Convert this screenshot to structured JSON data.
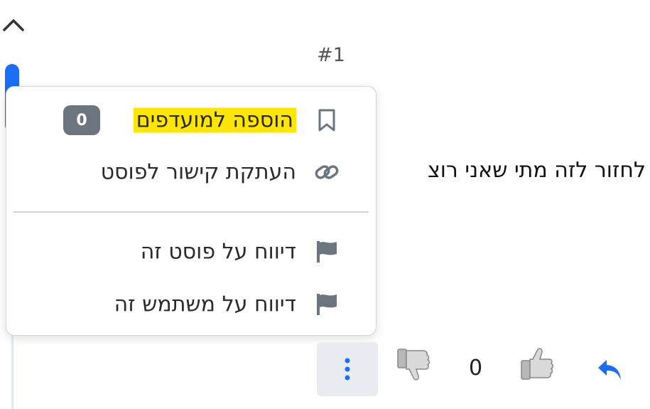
{
  "nav": {
    "collapse_icon": "chevron-up-icon"
  },
  "post": {
    "index": "#1",
    "text": "לחזור לזה מתי שאני רוצ",
    "vote_count": "0"
  },
  "menu": {
    "items": [
      {
        "icon": "bookmark-icon",
        "label": "הוספה למועדפים",
        "badge": "0"
      },
      {
        "icon": "link-icon",
        "label": "העתקת קישור לפוסט"
      },
      {
        "icon": "flag-icon",
        "label": "דיווח על פוסט זה"
      },
      {
        "icon": "flag-icon",
        "label": "דיווח על משתמש זה"
      }
    ]
  },
  "actions": {
    "more_icon": "vertical-dots-icon",
    "downvote_icon": "thumbs-down-icon",
    "upvote_icon": "thumbs-up-icon",
    "reply_icon": "reply-arrow-icon"
  },
  "colors": {
    "accent": "#1b6ef3",
    "highlight": "#ffe600",
    "badge": "#6c757d"
  }
}
